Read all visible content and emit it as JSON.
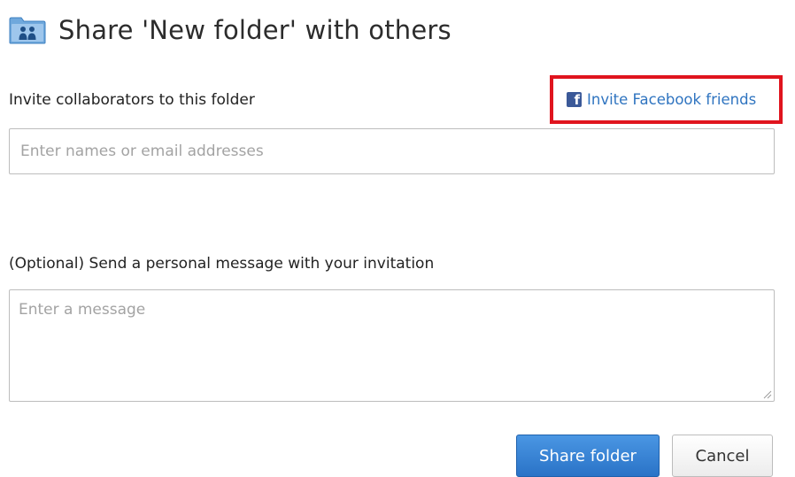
{
  "dialog": {
    "title": "Share 'New folder' with others",
    "title_icon": "shared-folder-icon"
  },
  "invite": {
    "label": "Invite collaborators to this folder",
    "facebook_link": "Invite Facebook friends",
    "facebook_icon": "facebook-icon",
    "facebook_icon_glyph": "f",
    "highlight_color": "#e0141e",
    "input_placeholder": "Enter names or email addresses",
    "input_value": ""
  },
  "message": {
    "label": "(Optional) Send a personal message with your invitation",
    "placeholder": "Enter a message",
    "value": ""
  },
  "buttons": {
    "share": "Share folder",
    "cancel": "Cancel"
  },
  "colors": {
    "primary_button": "#2f7fd4",
    "link": "#2f74c0",
    "facebook": "#3b5998"
  }
}
